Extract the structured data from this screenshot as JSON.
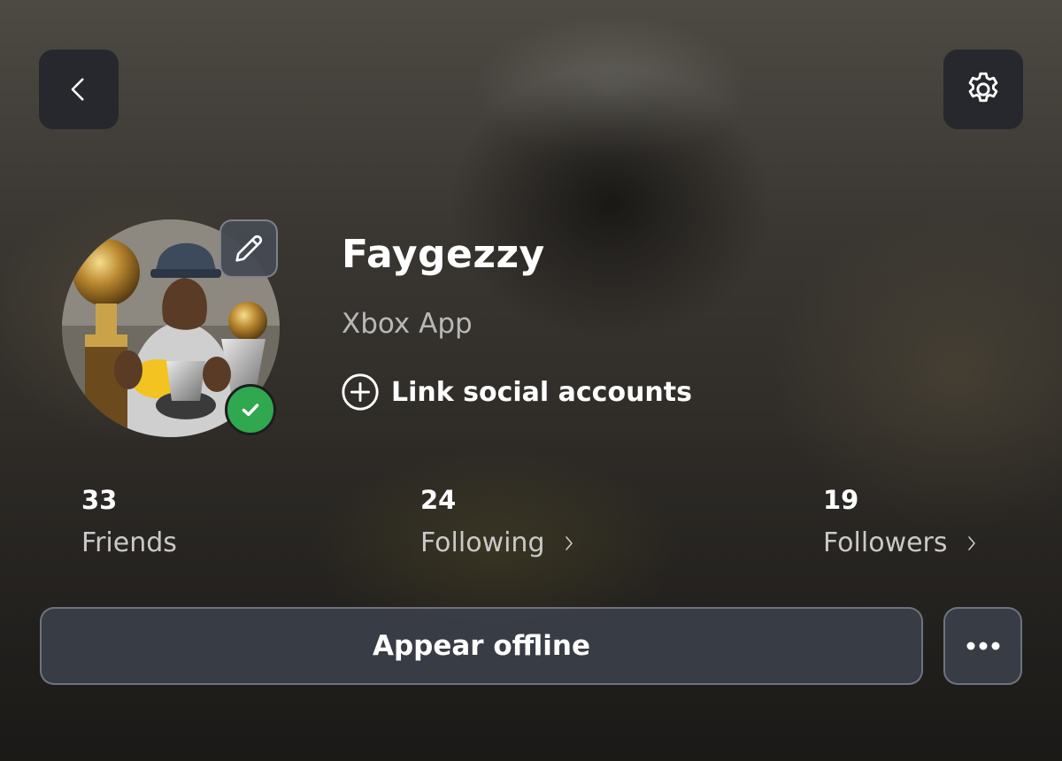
{
  "header": {
    "back_icon": "chevron-left-icon",
    "settings_icon": "gear-icon"
  },
  "profile": {
    "gamertag": "Faygezzy",
    "platform": "Xbox App",
    "status": "online",
    "status_color": "#2fa84f",
    "link_social_label": "Link social accounts"
  },
  "stats": [
    {
      "value": "33",
      "label": "Friends"
    },
    {
      "value": "24",
      "label": "Following"
    },
    {
      "value": "19",
      "label": "Followers"
    }
  ],
  "actions": {
    "appear_offline_label": "Appear offline",
    "more_icon": "more-horizontal-icon"
  }
}
